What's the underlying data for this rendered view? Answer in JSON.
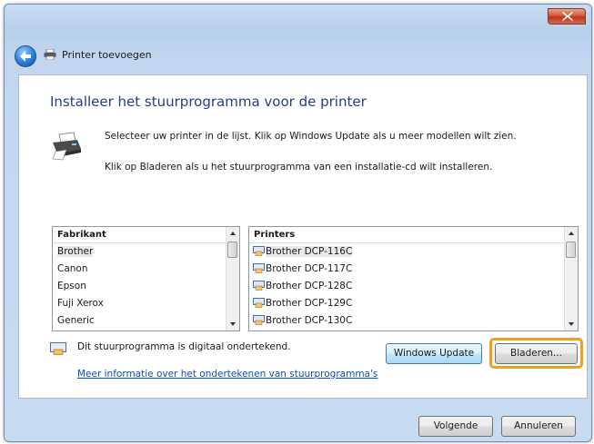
{
  "window": {
    "title": "Printer toevoegen"
  },
  "page": {
    "heading": "Installeer het stuurprogramma voor de printer",
    "instruction_1": "Selecteer uw printer in de lijst. Klik op Windows Update als u meer modellen wilt zien.",
    "instruction_2": "Klik op Bladeren als u het stuurprogramma van een installatie-cd wilt installeren."
  },
  "manufacturers": {
    "header": "Fabrikant",
    "items": [
      "Brother",
      "Canon",
      "Epson",
      "Fuji Xerox",
      "Generic"
    ],
    "selected": "Brother"
  },
  "printers": {
    "header": "Printers",
    "items": [
      "Brother DCP-116C",
      "Brother DCP-117C",
      "Brother DCP-128C",
      "Brother DCP-129C",
      "Brother DCP-130C"
    ],
    "selected": "Brother DCP-116C"
  },
  "signature": {
    "text": "Dit stuurprogramma is digitaal ondertekend.",
    "link": "Meer informatie over het ondertekenen van stuurprogramma's"
  },
  "buttons": {
    "windows_update": "Windows Update",
    "browse": "Bladeren...",
    "next": "Volgende",
    "cancel": "Annuleren"
  },
  "colors": {
    "heading": "#1e3f8a",
    "link": "#0a4fb5",
    "highlight_ring": "#f0a020",
    "close_button": "#c9452a"
  },
  "icons": {
    "close": "close-icon",
    "back": "back-arrow-icon",
    "printer": "printer-icon",
    "signed_driver": "signed-driver-icon"
  }
}
